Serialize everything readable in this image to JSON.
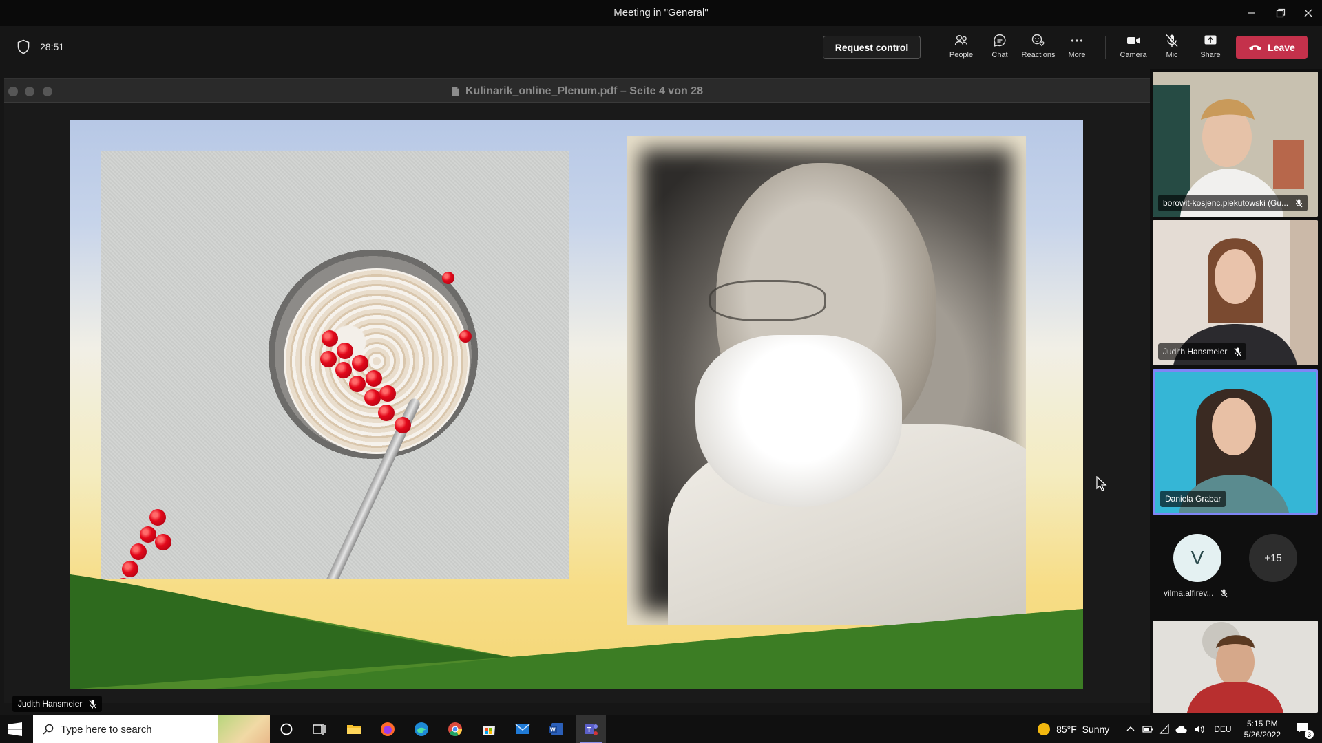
{
  "window": {
    "title": "Meeting in \"General\""
  },
  "meeting": {
    "elapsed": "28:51",
    "request_control_label": "Request control",
    "buttons": {
      "people": "People",
      "chat": "Chat",
      "reactions": "Reactions",
      "more": "More",
      "camera": "Camera",
      "mic": "Mic",
      "share": "Share"
    },
    "leave_label": "Leave",
    "accent": "#c4314b"
  },
  "shared_window": {
    "title": "Kulinarik_online_Plenum.pdf – Seite 4 von 28",
    "presenter_name": "Judith Hansmeier"
  },
  "participants": [
    {
      "name": "borowit-kosjenc.piekutowski (Gu...",
      "muted": true
    },
    {
      "name": "Judith Hansmeier",
      "muted": true
    },
    {
      "name": "Daniela Grabar",
      "muted": false,
      "active": true
    },
    {
      "name": "vilma.alfirev...",
      "initial": "V",
      "muted": true
    },
    {
      "overflow": "+15"
    }
  ],
  "taskbar": {
    "search_placeholder": "Type here to search",
    "weather": "85°F  Sunny",
    "language": "DEU",
    "time": "5:15 PM",
    "date": "5/26/2022",
    "notifications": "3"
  }
}
